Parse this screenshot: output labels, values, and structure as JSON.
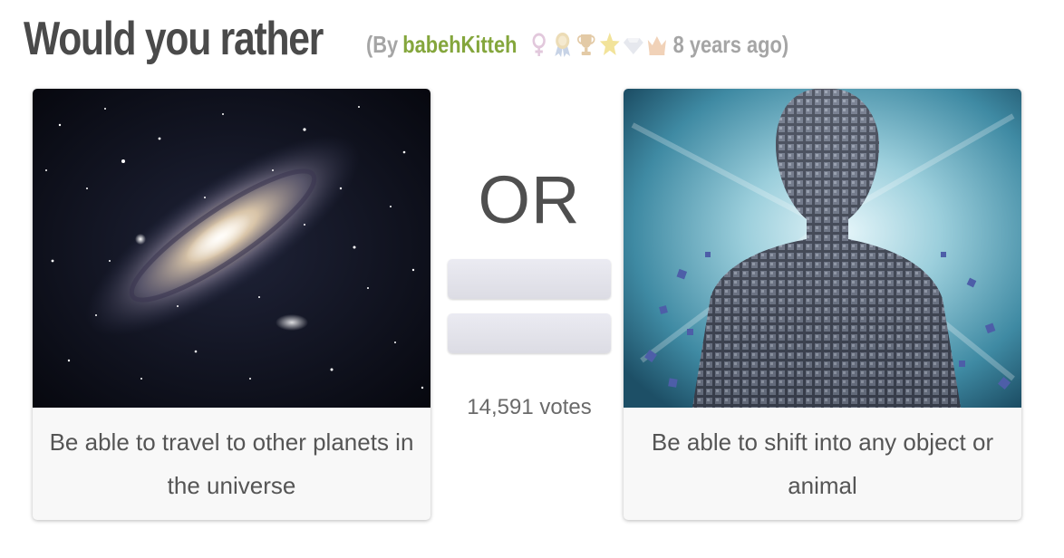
{
  "header": {
    "title": "Would you rather",
    "by_prefix": "(By",
    "author": "babehKitteh",
    "age": "8 years ago)",
    "badges": [
      "female-symbol-icon",
      "ribbon-icon",
      "trophy-icon",
      "star-icon",
      "diamond-icon",
      "crown-icon"
    ]
  },
  "options": [
    {
      "image": "galaxy-image",
      "caption": "Be able to travel to other planets in the universe"
    },
    {
      "image": "cube-man-image",
      "caption": "Be able to shift into any object or animal"
    }
  ],
  "middle": {
    "separator": "OR",
    "votes": "14,591 votes"
  },
  "colors": {
    "title": "#4a4a4a",
    "author": "#84a63c",
    "meta": "#a5a5a5"
  }
}
